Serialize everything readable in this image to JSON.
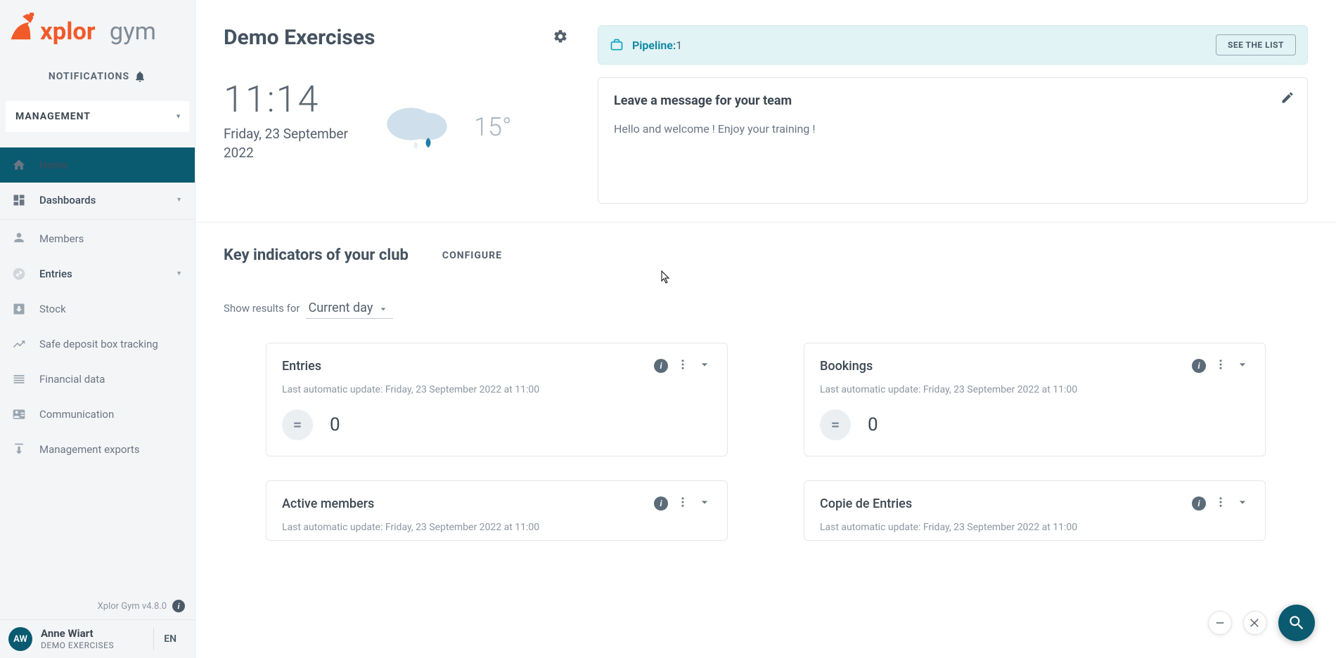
{
  "brand": {
    "name1": "xplor",
    "name2": "gym"
  },
  "notifications_label": "NOTIFICATIONS",
  "management_label": "MANAGEMENT",
  "nav": {
    "home": "Home",
    "dashboards": "Dashboards",
    "members": "Members",
    "entries": "Entries",
    "stock": "Stock",
    "safedeposit": "Safe deposit box tracking",
    "financial": "Financial data",
    "communication": "Communication",
    "exports": "Management exports"
  },
  "version": "Xplor Gym v4.8.0",
  "user": {
    "initials": "AW",
    "name": "Anne Wiart",
    "role": "DEMO EXERCISES"
  },
  "language": "EN",
  "page": {
    "title": "Demo Exercises",
    "time": "11:14",
    "date": "Friday, 23 September 2022",
    "temperature": "15°"
  },
  "pipeline": {
    "label": "Pipeline:",
    "value": "1",
    "see_list": "SEE THE LIST"
  },
  "message": {
    "title": "Leave a message for your team",
    "body": "Hello and welcome ! Enjoy your training !"
  },
  "indicators": {
    "title": "Key indicators of your club",
    "configure": "CONFIGURE",
    "filter_label": "Show results for",
    "filter_value": "Current day"
  },
  "kpi": {
    "update_prefix": "Last automatic update: ",
    "update_time": "Friday, 23 September 2022 at 11:00",
    "cards": [
      {
        "title": "Entries",
        "value": "0",
        "trend": "="
      },
      {
        "title": "Bookings",
        "value": "0",
        "trend": "="
      },
      {
        "title": "Active members",
        "value": "",
        "trend": ""
      },
      {
        "title": "Copie de Entries",
        "value": "",
        "trend": ""
      }
    ]
  }
}
